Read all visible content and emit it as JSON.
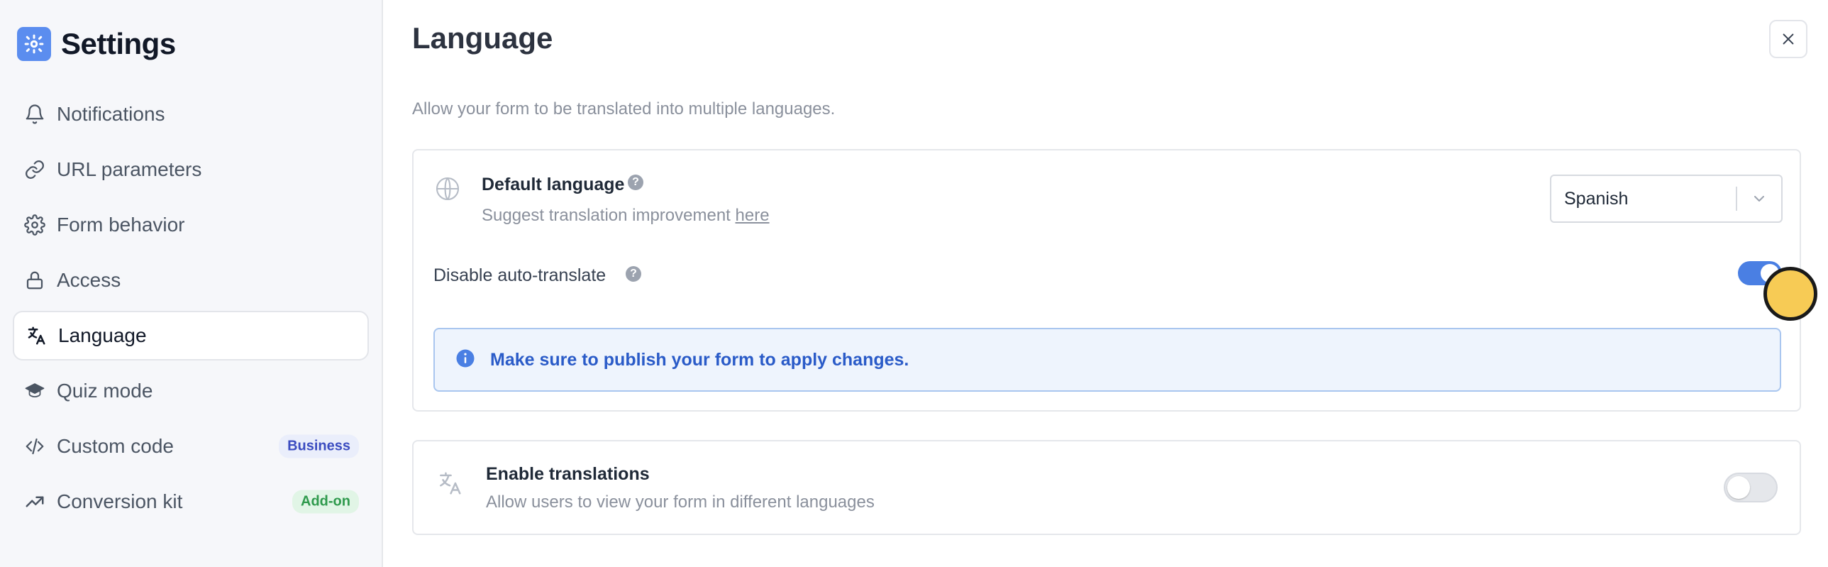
{
  "sidebar": {
    "title": "Settings",
    "items": [
      {
        "label": "Notifications",
        "icon": "bell-icon"
      },
      {
        "label": "URL parameters",
        "icon": "link-icon"
      },
      {
        "label": "Form behavior",
        "icon": "gear-icon"
      },
      {
        "label": "Access",
        "icon": "lock-icon"
      },
      {
        "label": "Language",
        "icon": "translate-icon",
        "active": true
      },
      {
        "label": "Quiz mode",
        "icon": "graduation-cap-icon"
      },
      {
        "label": "Custom code",
        "icon": "code-icon",
        "badge": "Business"
      },
      {
        "label": "Conversion kit",
        "icon": "trending-up-icon",
        "badge": "Add-on"
      }
    ]
  },
  "main": {
    "title": "Language",
    "subtitle": "Allow your form to be translated into multiple languages.",
    "default_language": {
      "label": "Default language",
      "help": "?",
      "desc_prefix": "Suggest translation improvement ",
      "desc_link": "here",
      "selected": "Spanish"
    },
    "auto_translate": {
      "label": "Disable auto-translate",
      "help": "?",
      "enabled": true
    },
    "info_message": "Make sure to publish your form to apply changes.",
    "translations": {
      "title": "Enable translations",
      "desc": "Allow users to view your form in different languages",
      "enabled": false
    }
  },
  "colors": {
    "accent": "#4a7fe3",
    "brand_icon": "#5b8def",
    "info_text": "#2a5bc8",
    "badge_business": "#3b4cc0",
    "badge_addon": "#2f9a4d"
  }
}
